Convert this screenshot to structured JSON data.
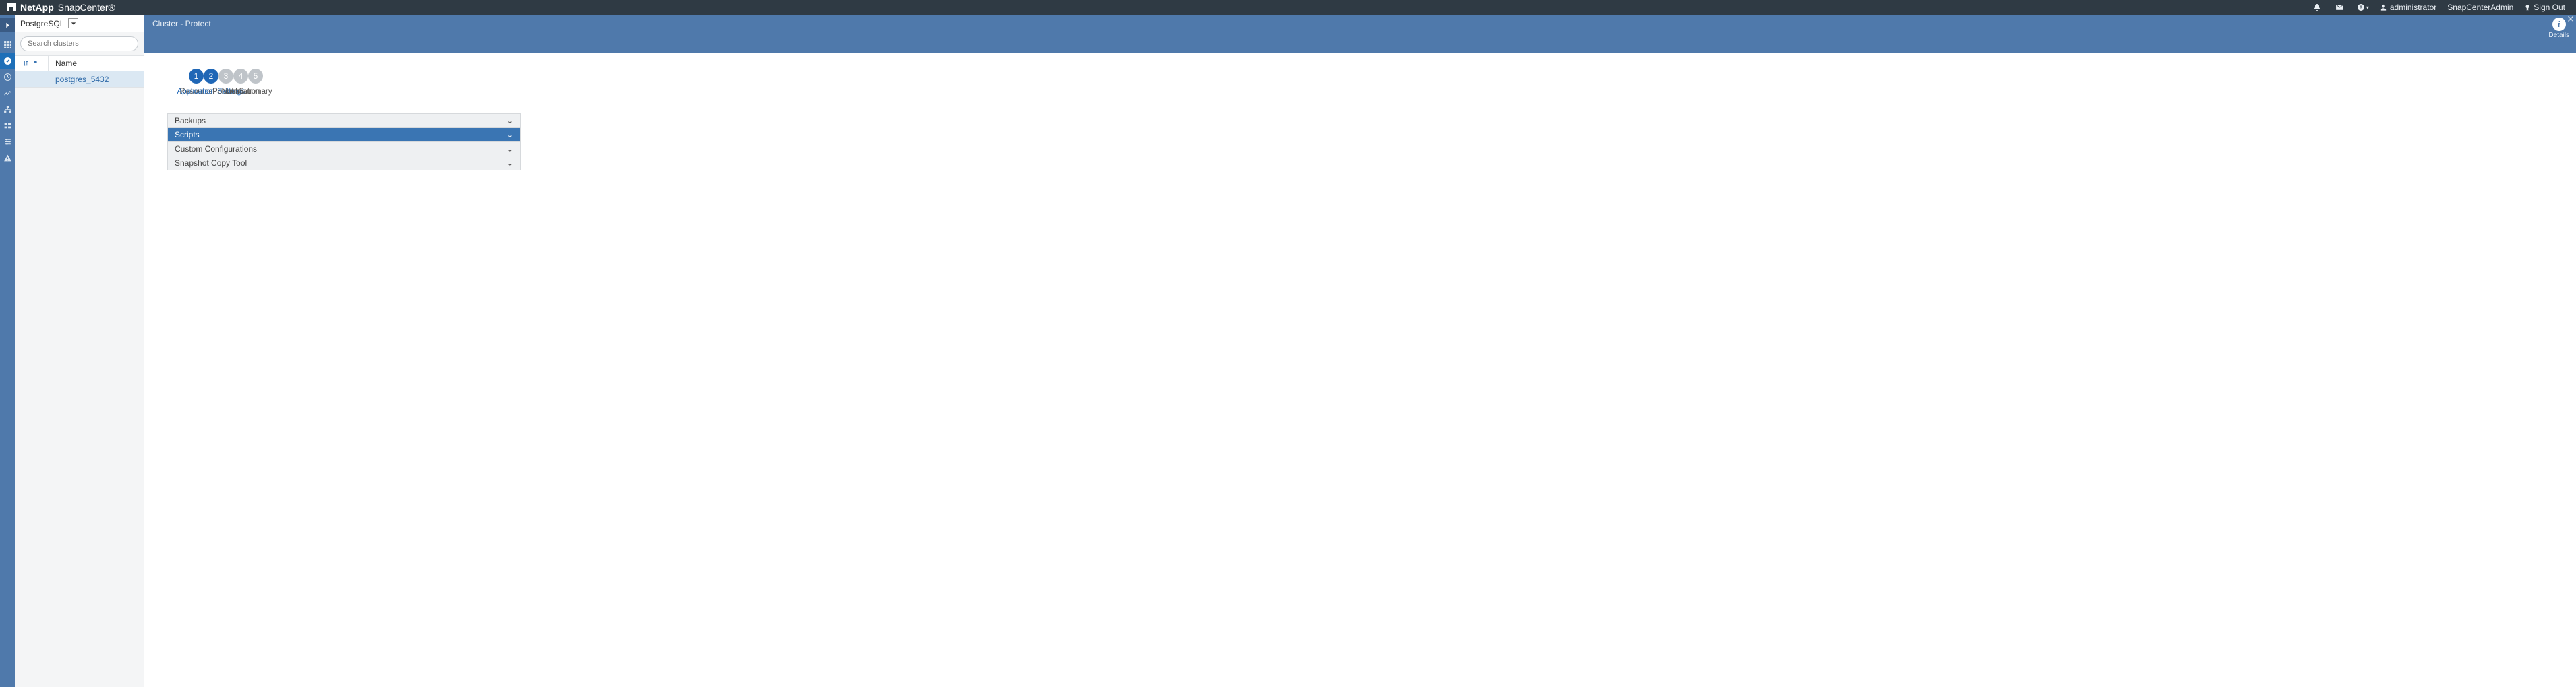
{
  "brand": {
    "company": "NetApp",
    "product": "SnapCenter®"
  },
  "topbar": {
    "user_role": "administrator",
    "admin_label": "SnapCenterAdmin",
    "signout_label": "Sign Out"
  },
  "subheader": {
    "breadcrumb": "Cluster - Protect",
    "details_label": "Details"
  },
  "sidebar": {
    "view_label": "PostgreSQL",
    "search_placeholder": "Search clusters",
    "columns": {
      "name": "Name"
    },
    "rows": [
      {
        "name": "postgres_5432"
      }
    ]
  },
  "stepper": {
    "steps": [
      {
        "num": "1",
        "label": "Resource",
        "state": "done"
      },
      {
        "num": "2",
        "label": "Application Settings",
        "state": "current"
      },
      {
        "num": "3",
        "label": "Policies",
        "state": "todo"
      },
      {
        "num": "4",
        "label": "Notification",
        "state": "todo"
      },
      {
        "num": "5",
        "label": "Summary",
        "state": "todo"
      }
    ]
  },
  "accordion": {
    "items": [
      {
        "title": "Backups",
        "active": false
      },
      {
        "title": "Scripts",
        "active": true
      },
      {
        "title": "Custom Configurations",
        "active": false
      },
      {
        "title": "Snapshot Copy Tool",
        "active": false
      }
    ]
  },
  "colors": {
    "topbar_bg": "#2f3a44",
    "blue_header": "#4f79ab",
    "active_blue": "#2067b6",
    "accordion_active": "#3a75b3"
  }
}
